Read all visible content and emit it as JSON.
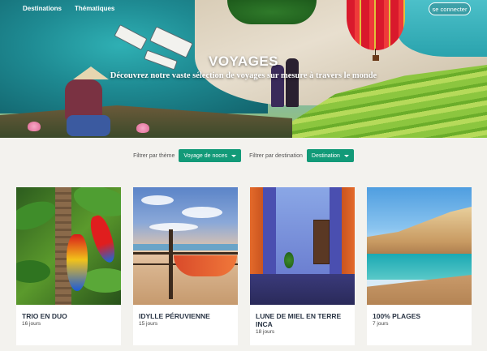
{
  "nav": {
    "items": [
      "Destinations",
      "Thématiques"
    ],
    "connect_label": "se connecter"
  },
  "hero": {
    "title": "VOYAGES",
    "subtitle": "Découvrez notre vaste sélection de voyages sur mesure à travers le monde"
  },
  "filters": {
    "theme_label": "Filtrer par thème",
    "theme_value": "Voyage de noces",
    "destination_label": "Filtrer par destination",
    "destination_value": "Destination"
  },
  "cards": [
    {
      "title": "TRIO EN DUO",
      "duration": "16 jours"
    },
    {
      "title": "IDYLLE PÉRUVIENNE",
      "duration": "15 jours"
    },
    {
      "title": "LUNE DE MIEL EN TERRE INCA",
      "duration": "18 jours"
    },
    {
      "title": "100% PLAGES",
      "duration": "7 jours"
    }
  ],
  "colors": {
    "accent": "#129a78",
    "title_text": "#2a3545",
    "page_bg": "#f3f2ee"
  },
  "icons": {
    "dropdown": "caret-down-icon"
  }
}
